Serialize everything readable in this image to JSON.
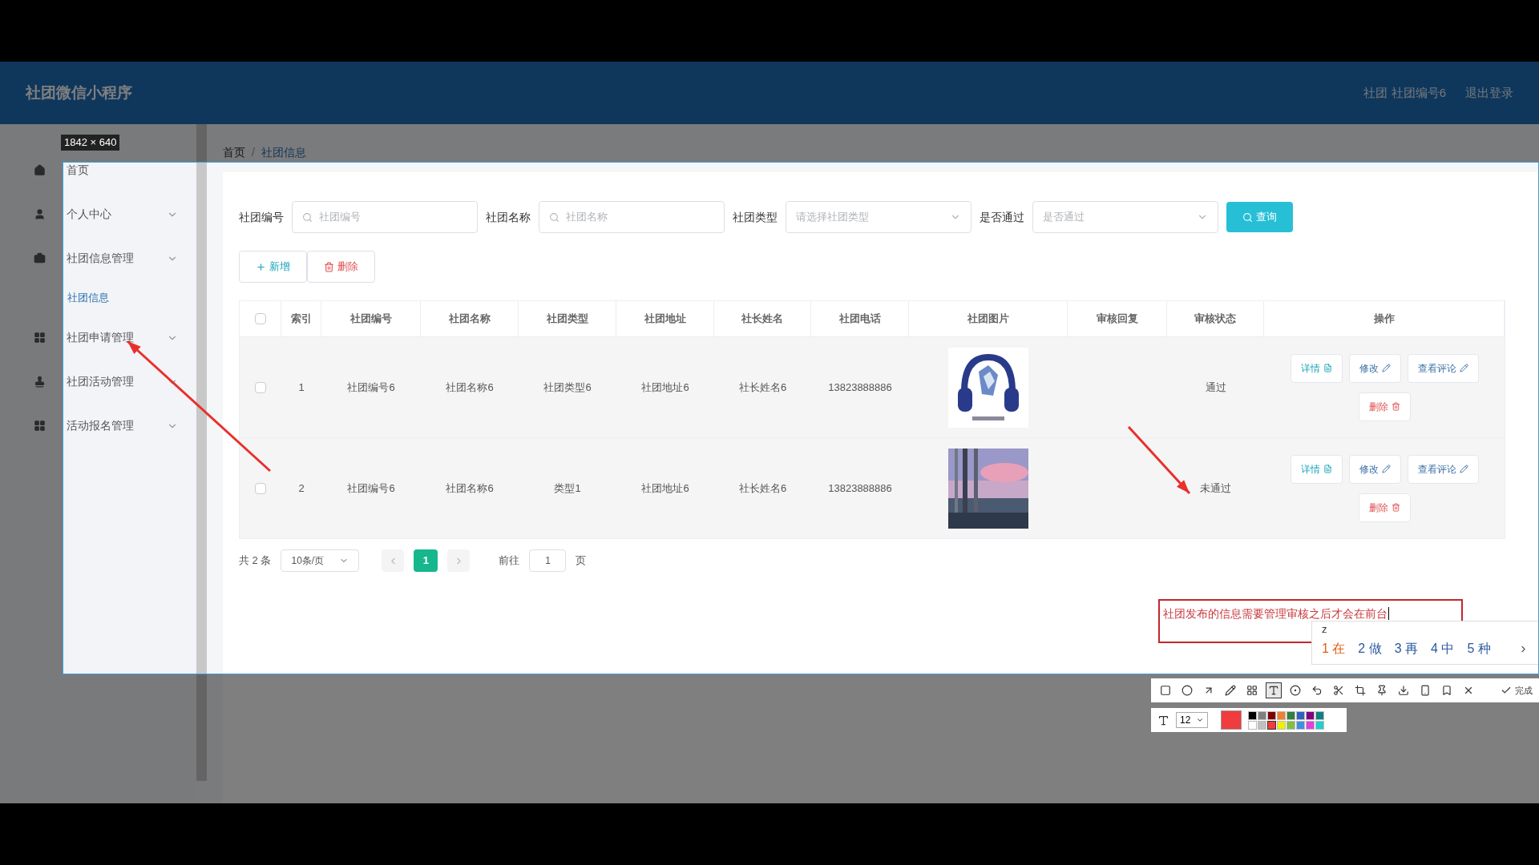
{
  "app": {
    "title": "社团微信小程序",
    "user": "社团 社团编号6",
    "logout": "退出登录"
  },
  "sidebar": [
    {
      "label": "首页",
      "kind": "home"
    },
    {
      "label": "个人中心",
      "kind": "user"
    },
    {
      "label": "社团信息管理",
      "kind": "briefcase",
      "children": [
        {
          "label": "社团信息",
          "selected": true
        }
      ]
    },
    {
      "label": "社团申请管理",
      "kind": "grid"
    },
    {
      "label": "社团活动管理",
      "kind": "stamp"
    },
    {
      "label": "活动报名管理",
      "kind": "grid"
    }
  ],
  "breadcrumb": {
    "items": [
      "首页",
      "社团信息"
    ],
    "separator": "/"
  },
  "search": {
    "fields": [
      {
        "label": "社团编号",
        "placeholder": "社团编号",
        "kind": "input"
      },
      {
        "label": "社团名称",
        "placeholder": "社团名称",
        "kind": "input"
      },
      {
        "label": "社团类型",
        "placeholder": "请选择社团类型",
        "kind": "select"
      },
      {
        "label": "是否通过",
        "placeholder": "是否通过",
        "kind": "select"
      }
    ],
    "button": "查询"
  },
  "actions": [
    {
      "label": "新增",
      "kind": "add"
    },
    {
      "label": "删除",
      "kind": "delete"
    }
  ],
  "table": {
    "header_checked": false,
    "columns": [
      "索引",
      "社团编号",
      "社团名称",
      "社团类型",
      "社团地址",
      "社长姓名",
      "社团电话",
      "社团图片",
      "审核回复",
      "审核状态",
      "操作"
    ],
    "rows": [
      {
        "checked": false,
        "cells": [
          "1",
          "社团编号6",
          "社团名称6",
          "社团类型6",
          "社团地址6",
          "社长姓名6",
          "13823888886"
        ],
        "picture": {
          "kind": "picture"
        },
        "status": "通过",
        "actions": [
          {
            "label": "详情",
            "kind": "detail"
          },
          {
            "label": "修改",
            "kind": "edit"
          },
          {
            "label": "查看评论",
            "kind": "comments"
          },
          {
            "label": "删除",
            "kind": "delete"
          }
        ]
      },
      {
        "checked": false,
        "cells": [
          "2",
          "社团编号6",
          "社团名称6",
          "类型1",
          "社团地址6",
          "社长姓名6",
          "13823888886"
        ],
        "picture": {
          "kind": "picture"
        },
        "status": "未通过",
        "actions": [
          {
            "label": "详情",
            "kind": "detail"
          },
          {
            "label": "修改",
            "kind": "edit"
          },
          {
            "label": "查看评论",
            "kind": "comments"
          },
          {
            "label": "删除",
            "kind": "delete"
          }
        ]
      }
    ]
  },
  "pagination": {
    "total": "共 2 条",
    "page_size": "10条/页",
    "pages": [
      {
        "label": "1",
        "selected": true
      }
    ],
    "goto_label": "前往",
    "goto_value": "1",
    "page_unit": "页"
  },
  "capture": {
    "selection_size": "1842 × 640",
    "annotation_text": "社团发布的信息需要管理审核之后才会在前台",
    "ime": {
      "input": "z",
      "candidates": [
        {
          "label": "1",
          "text": "在",
          "selected": true
        },
        {
          "label": "2",
          "text": "做",
          "selected": false
        },
        {
          "label": "3",
          "text": "再",
          "selected": false
        },
        {
          "label": "4",
          "text": "中",
          "selected": false
        },
        {
          "label": "5",
          "text": "种",
          "selected": false
        }
      ]
    },
    "tools": [
      {
        "kind": "rectangle",
        "selected": false
      },
      {
        "kind": "ellipse",
        "selected": false
      },
      {
        "kind": "arrow",
        "selected": false
      },
      {
        "kind": "pencil",
        "selected": false
      },
      {
        "kind": "mosaic",
        "selected": false
      },
      {
        "kind": "text",
        "selected": true
      },
      {
        "kind": "counter",
        "selected": false
      },
      {
        "kind": "undo",
        "selected": false
      },
      {
        "kind": "cut",
        "selected": false
      },
      {
        "kind": "crop",
        "selected": false
      },
      {
        "kind": "pin",
        "selected": false
      },
      {
        "kind": "save",
        "selected": false
      },
      {
        "kind": "phone",
        "selected": false
      },
      {
        "kind": "bookmark",
        "selected": false
      },
      {
        "kind": "close",
        "selected": false
      }
    ],
    "done": "完成",
    "font_size": "12",
    "palette": [
      {
        "color": "#000000",
        "selected": false
      },
      {
        "color": "#808080",
        "selected": false
      },
      {
        "color": "#800000",
        "selected": false
      },
      {
        "color": "#f08030",
        "selected": false
      },
      {
        "color": "#308040",
        "selected": false
      },
      {
        "color": "#3060c0",
        "selected": false
      },
      {
        "color": "#800080",
        "selected": false
      },
      {
        "color": "#108080",
        "selected": false
      },
      {
        "color": "#ffffff",
        "selected": false
      },
      {
        "color": "#c0c0c0",
        "selected": false
      },
      {
        "color": "#f03c3c",
        "selected": true
      },
      {
        "color": "#f0f000",
        "selected": false
      },
      {
        "color": "#80c040",
        "selected": false
      },
      {
        "color": "#4090e0",
        "selected": false
      },
      {
        "color": "#e040e0",
        "selected": false
      },
      {
        "color": "#20d0d0",
        "selected": false
      }
    ]
  }
}
